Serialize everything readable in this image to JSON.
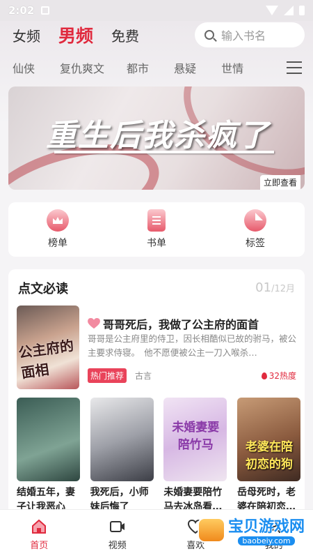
{
  "status_bar": {
    "time": "2:02"
  },
  "top_tabs": [
    {
      "label": "女频",
      "active": false
    },
    {
      "label": "男频",
      "active": true
    },
    {
      "label": "免费",
      "active": false
    }
  ],
  "search": {
    "placeholder": "输入书名"
  },
  "categories": [
    "仙侠",
    "复仇爽文",
    "都市",
    "悬疑",
    "世情"
  ],
  "banner": {
    "title": "重生后我杀疯了",
    "cta": "立即查看"
  },
  "quick_entries": [
    {
      "label": "榜单",
      "icon": "crown-icon"
    },
    {
      "label": "书单",
      "icon": "document-icon"
    },
    {
      "label": "标签",
      "icon": "tag-icon"
    }
  ],
  "daily": {
    "heading": "点文必读",
    "date_day": "01",
    "date_month": "/12月",
    "featured": {
      "cover_text": "公主府的面相",
      "title": "哥哥死后，我做了公主府的面首",
      "description": "哥哥是公主府里的侍卫，因长相酷似已故的驸马，被公主要求侍寝。　他不愿便被公主一刀入喉杀…",
      "badge": "热门推荐",
      "genre": "古言",
      "heat": "32热度"
    },
    "books": [
      {
        "title": "结婚五年，妻子让我恶心",
        "cover_text": ""
      },
      {
        "title": "我死后，小师妹后悔了",
        "cover_text": ""
      },
      {
        "title": "未婚妻要陪竹马去冰岛看…",
        "cover_text": "未婚妻要陪竹马"
      },
      {
        "title": "岳母死时，老婆在陪初恋…",
        "cover_text": "老婆在陪初恋的狗"
      }
    ]
  },
  "nav": [
    {
      "label": "首页",
      "icon": "home-icon",
      "active": true
    },
    {
      "label": "视频",
      "icon": "video-icon",
      "active": false
    },
    {
      "label": "喜欢",
      "icon": "heart-icon",
      "active": false
    },
    {
      "label": "我的",
      "icon": "profile-icon",
      "active": false
    }
  ],
  "watermark": {
    "title": "宝贝游戏网",
    "url": "baobeiy.com"
  },
  "colors": {
    "accent": "#e02a3e",
    "badge": "#e9435a",
    "watermark": "#1b8ef0"
  }
}
